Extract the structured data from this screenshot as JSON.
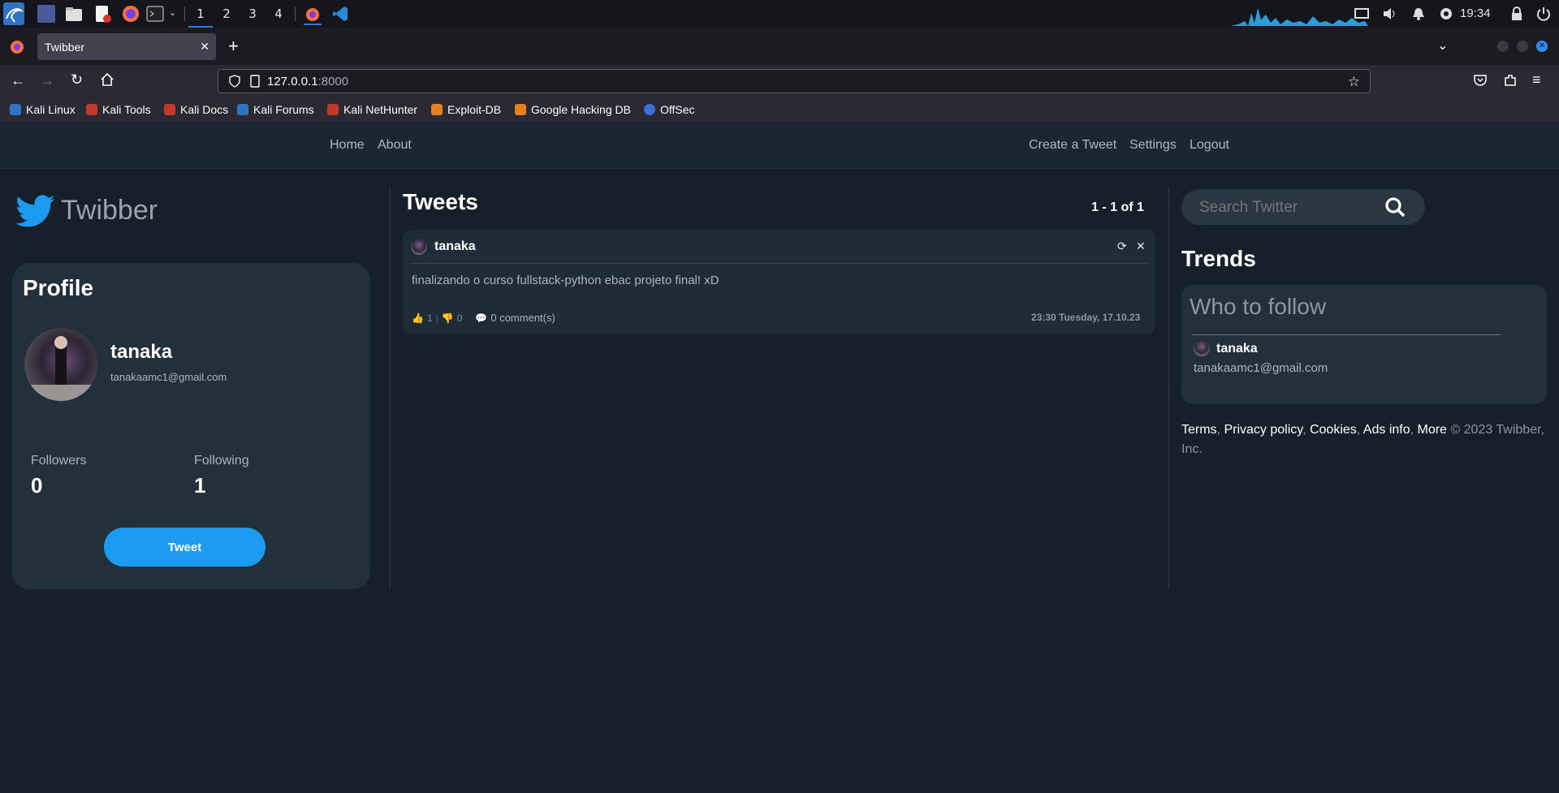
{
  "taskbar": {
    "workspaces": [
      "1",
      "2",
      "3",
      "4"
    ],
    "clock": "19:34"
  },
  "browser": {
    "tab_title": "Twibber",
    "url_host": "127.0.0.1",
    "url_port": ":8000",
    "bookmarks": [
      "Kali Linux",
      "Kali Tools",
      "Kali Docs",
      "Kali Forums",
      "Kali NetHunter",
      "Exploit-DB",
      "Google Hacking DB",
      "OffSec"
    ]
  },
  "nav": {
    "home": "Home",
    "about": "About",
    "create": "Create a Tweet",
    "settings": "Settings",
    "logout": "Logout"
  },
  "brand": "Twibber",
  "profile": {
    "heading": "Profile",
    "name": "tanaka",
    "email": "tanakaamc1@gmail.com",
    "followers_label": "Followers",
    "followers": "0",
    "following_label": "Following",
    "following": "1",
    "tweet_button": "Tweet"
  },
  "tweets": {
    "heading": "Tweets",
    "pagination": "1 - 1 of 1",
    "items": [
      {
        "author": "tanaka",
        "text": "finalizando o curso fullstack-python ebac projeto final! xD",
        "likes": "1",
        "dislikes": "0",
        "comments": "0 comment(s)",
        "timestamp": "23:30 Tuesday, 17.10.23"
      }
    ]
  },
  "search": {
    "placeholder": "Search Twitter"
  },
  "trends": {
    "heading": "Trends",
    "who_to_follow": "Who to follow",
    "suggest_name": "tanaka",
    "suggest_email": "tanakaamc1@gmail.com"
  },
  "footer": {
    "terms": "Terms",
    "privacy": "Privacy policy",
    "cookies": "Cookies",
    "ads": "Ads info",
    "more": "More",
    "copyright": "© 2023 Twibber, Inc."
  },
  "colors": {
    "accent": "#1d9bf0",
    "page_bg": "#15202b",
    "card_bg": "#22303c"
  }
}
